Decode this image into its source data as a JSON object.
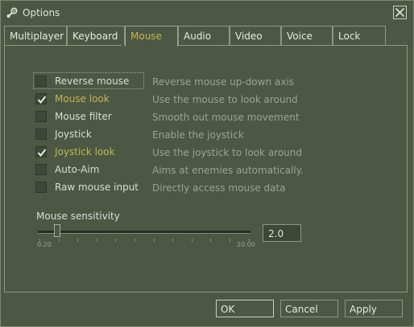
{
  "window": {
    "title": "Options"
  },
  "tabs": [
    {
      "label": "Multiplayer",
      "active": false
    },
    {
      "label": "Keyboard",
      "active": false
    },
    {
      "label": "Mouse",
      "active": true
    },
    {
      "label": "Audio",
      "active": false
    },
    {
      "label": "Video",
      "active": false
    },
    {
      "label": "Voice",
      "active": false
    },
    {
      "label": "Lock",
      "active": false
    }
  ],
  "options": [
    {
      "label": "Reverse mouse",
      "description": "Reverse mouse up-down axis",
      "checked": false
    },
    {
      "label": "Mouse look",
      "description": "Use the mouse to look around",
      "checked": true
    },
    {
      "label": "Mouse filter",
      "description": "Smooth out mouse movement",
      "checked": false
    },
    {
      "label": "Joystick",
      "description": "Enable the joystick",
      "checked": false
    },
    {
      "label": "Joystick look",
      "description": "Use the joystick to look around",
      "checked": true
    },
    {
      "label": "Auto-Aim",
      "description": "Aims at enemies automatically.",
      "checked": false
    },
    {
      "label": "Raw mouse input",
      "description": "Directly access mouse data",
      "checked": false
    }
  ],
  "sensitivity": {
    "label": "Mouse sensitivity",
    "min_label": "0.20",
    "max_label": "20.00",
    "value_text": "2.0",
    "min": 0.2,
    "max": 20.0,
    "value": 2.0
  },
  "buttons": {
    "ok": "OK",
    "cancel": "Cancel",
    "apply": "Apply"
  },
  "colors": {
    "accent": "#c4b550",
    "background": "#4c5844",
    "text": "#d8ded3"
  }
}
